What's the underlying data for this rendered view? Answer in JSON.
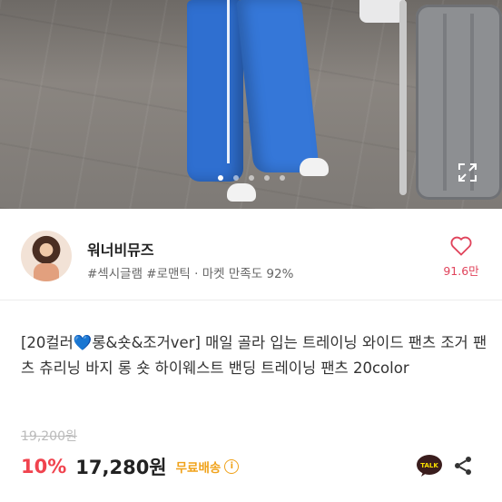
{
  "hero": {
    "total_images": 5,
    "active_index": 0
  },
  "shop": {
    "name": "워너비뮤즈",
    "tags": "#섹시글램 #로맨틱 · 마켓 만족도 92%",
    "like_count": "91.6만"
  },
  "product": {
    "title_prefix": "[20컬러",
    "title_heart": "💙",
    "title_rest": "롱&숏&조거ver] 매일 골라 입는 트레이닝 와이드 팬츠 조거 팬츠 츄리닝 바지 롱 숏 하이웨스트 밴딩 트레이닝 팬츠  20color",
    "original_price": "19,200원",
    "discount": "10%",
    "price": "17,280원",
    "shipping": "무료배송",
    "talk_label": "TALK"
  },
  "colors": {
    "discount": "#f0434e",
    "shipping": "#f0a21a",
    "like": "#e0435b"
  }
}
